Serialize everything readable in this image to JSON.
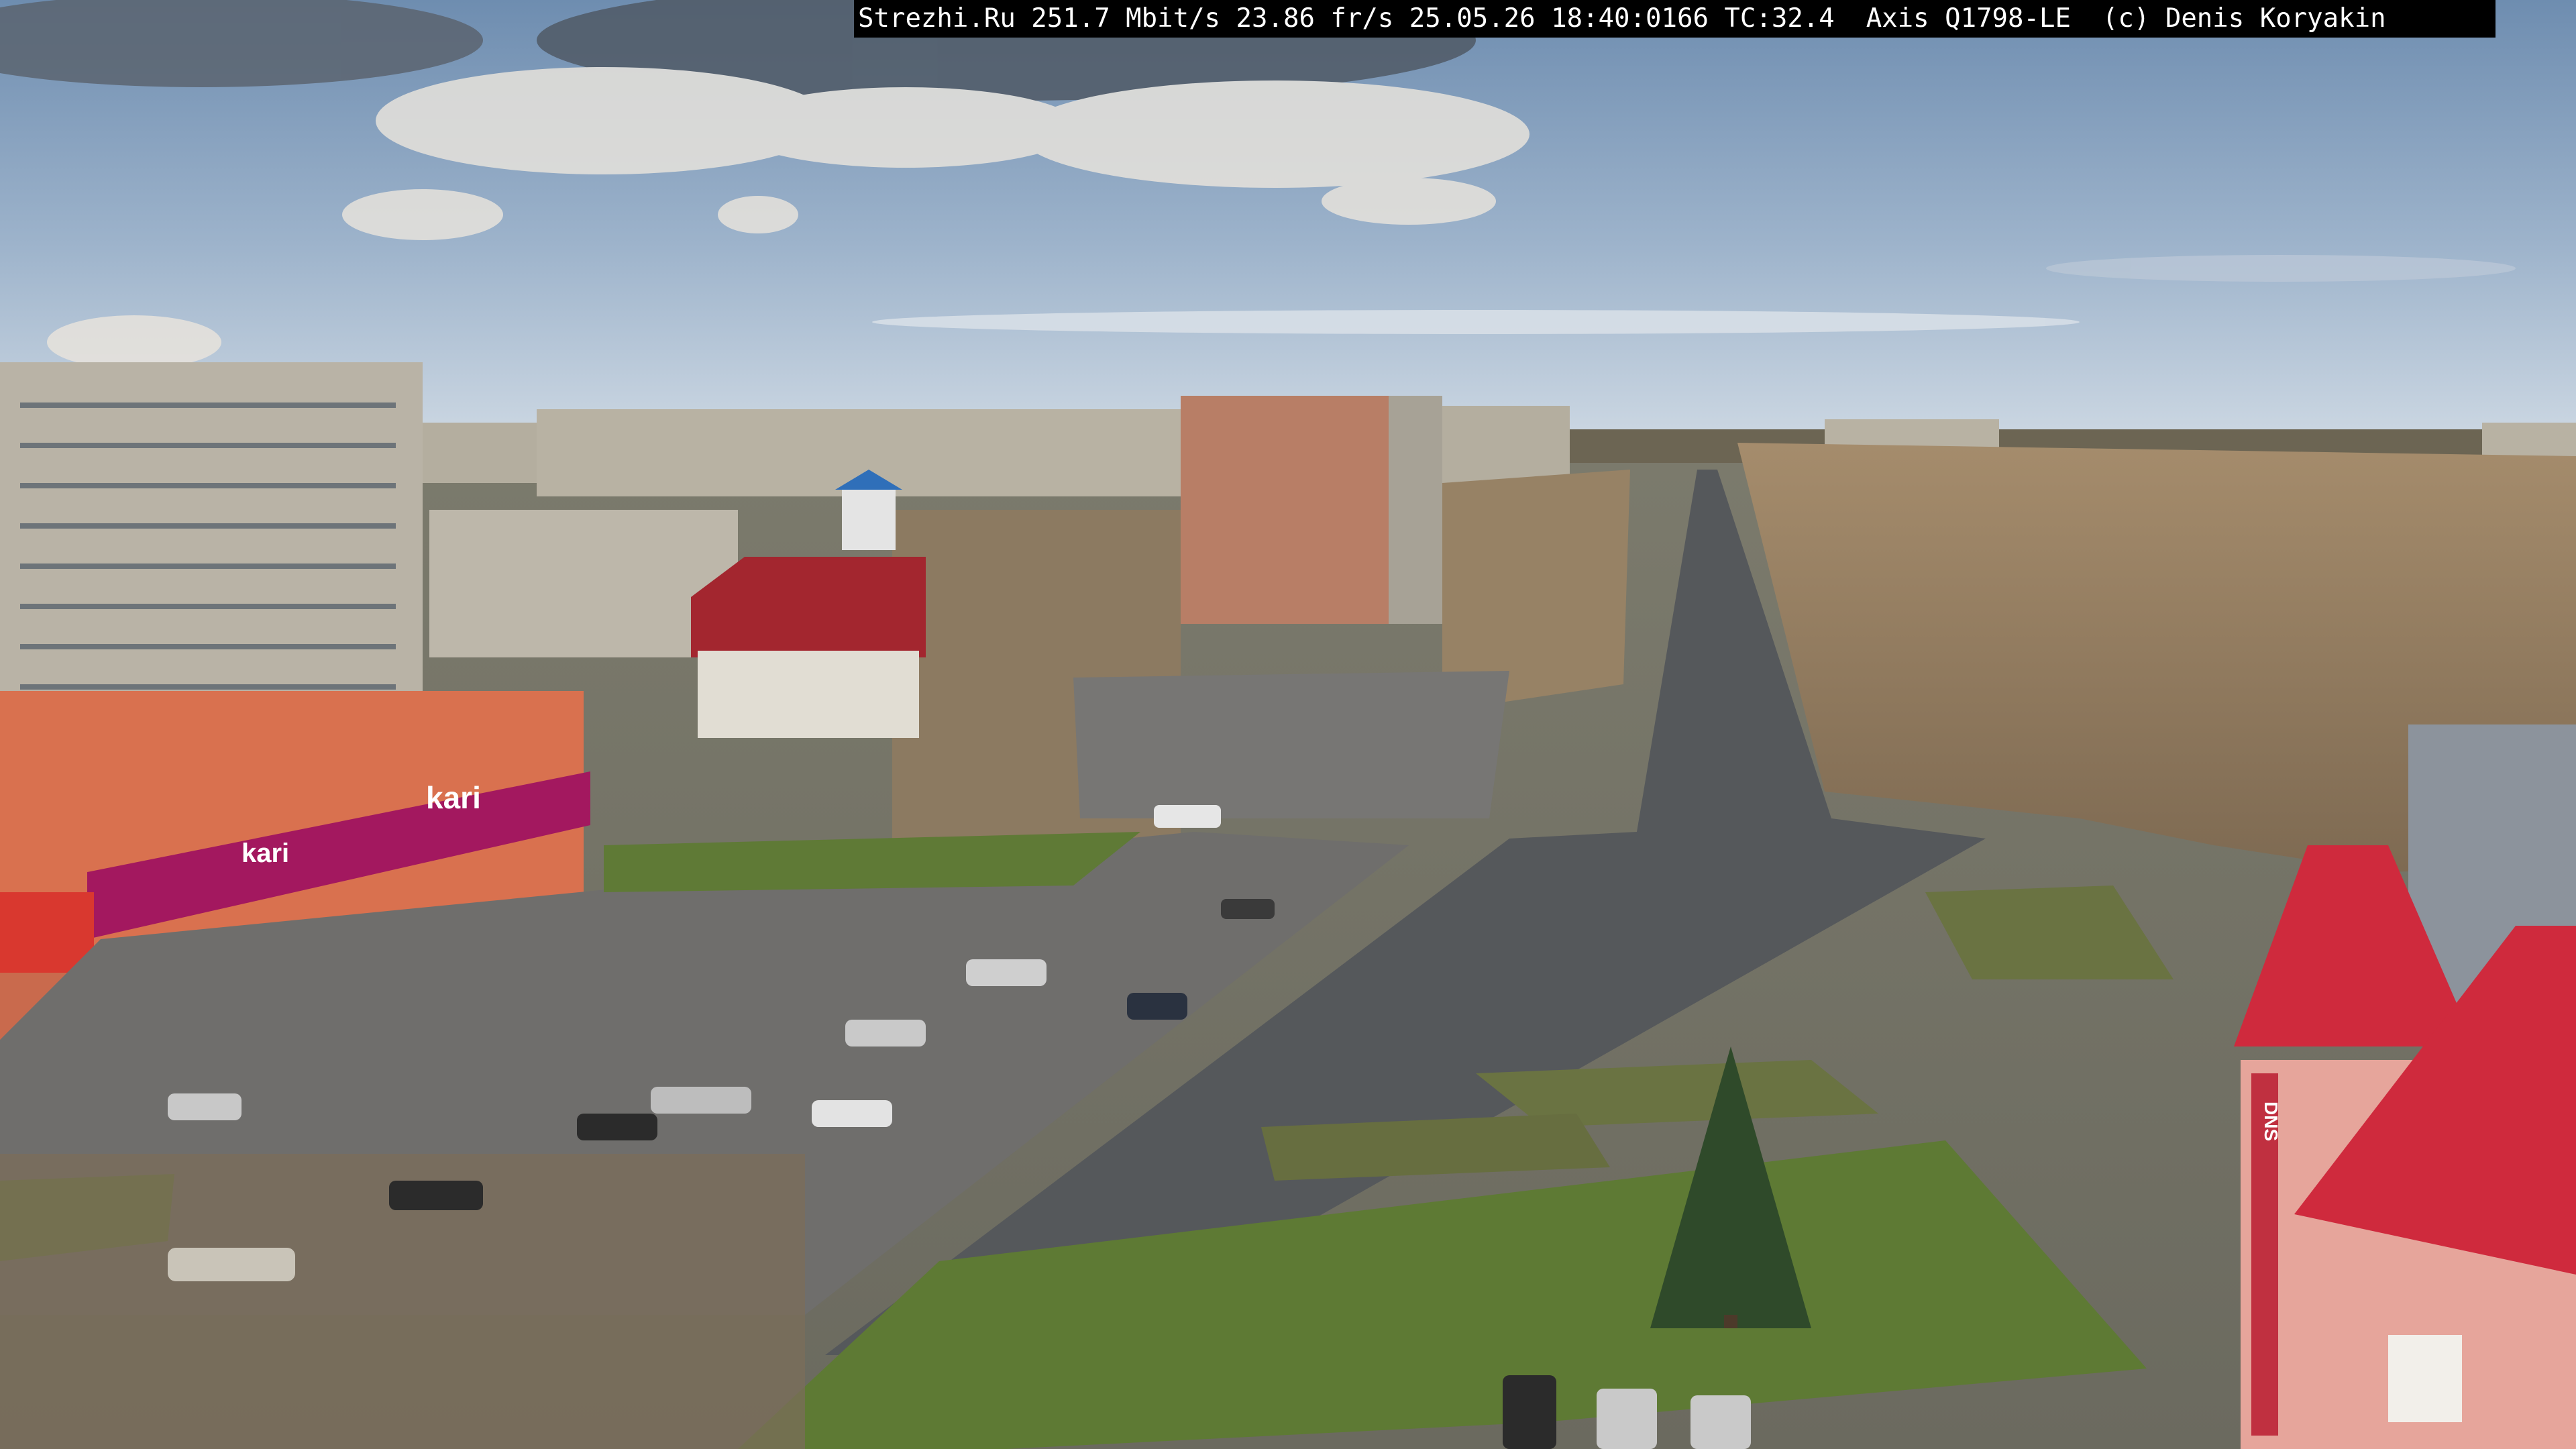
{
  "camera_overlay": {
    "text": "Strezhi.Ru 251.7 Mbit/s 23.86 fr/s 25.05.26 18:40:0166 TC:32.4  Axis Q1798-LE  (c) Denis Koryakin"
  },
  "signs": {
    "kari_roof": "kari",
    "kari_facade": "kari",
    "dns": "DNS"
  },
  "colors": {
    "sky_top": "#6f8fb3",
    "sky_horizon": "#c9d6e4",
    "grass": "#5e7a34",
    "asphalt": "#5b5e60",
    "kari_magenta": "#a3185f",
    "roof_red": "#c8283c",
    "panel_building": "#b9b3a6"
  }
}
